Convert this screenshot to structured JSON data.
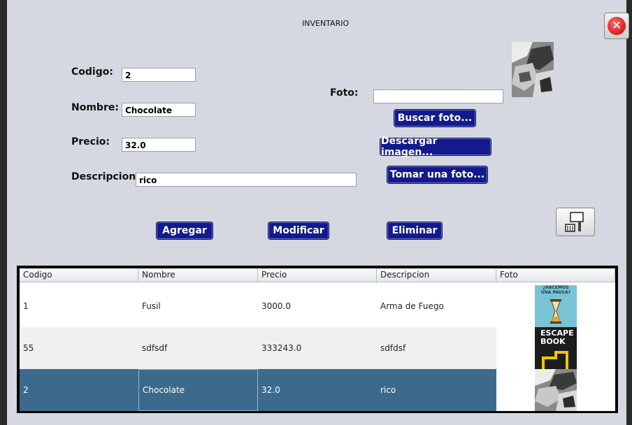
{
  "window": {
    "title": "INVENTARIO"
  },
  "form": {
    "codigo": {
      "label": "Codigo:",
      "value": "2"
    },
    "nombre": {
      "label": "Nombre:",
      "value": "Chocolate"
    },
    "precio": {
      "label": "Precio:",
      "value": "32.0"
    },
    "descripcion": {
      "label": "Descripcion:",
      "value": "rico"
    },
    "foto": {
      "label": "Foto:",
      "value": ""
    }
  },
  "photo_buttons": {
    "buscar": "Buscar foto...",
    "descargar": "Descargar imagen...",
    "tomar": "Tomar una foto..."
  },
  "actions": {
    "agregar": "Agregar",
    "modificar": "Modificar",
    "eliminar": "Eliminar"
  },
  "table": {
    "columns": [
      "Codigo",
      "Nombre",
      "Precio",
      "Descripcion",
      "Foto"
    ],
    "rows": [
      {
        "codigo": "1",
        "nombre": "Fusil",
        "precio": "3000.0",
        "descripcion": "Arma de Fuego",
        "foto_text": [
          "¿HACEMOS",
          "UNA PAUSA?"
        ]
      },
      {
        "codigo": "55",
        "nombre": "sdfsdf",
        "precio": "333243.0",
        "descripcion": "sdfdsf",
        "foto_text": [
          "ESCAPE",
          "BOOK"
        ]
      },
      {
        "codigo": "2",
        "nombre": "Chocolate",
        "precio": "32.0",
        "descripcion": "rico"
      }
    ],
    "selected_row": 2
  },
  "icons": {
    "close": "close-icon",
    "clear": "broom-icon"
  },
  "colors": {
    "button_bg": "#131a8e",
    "selection": "#3c6a8c",
    "background": "#d5d8e0"
  }
}
